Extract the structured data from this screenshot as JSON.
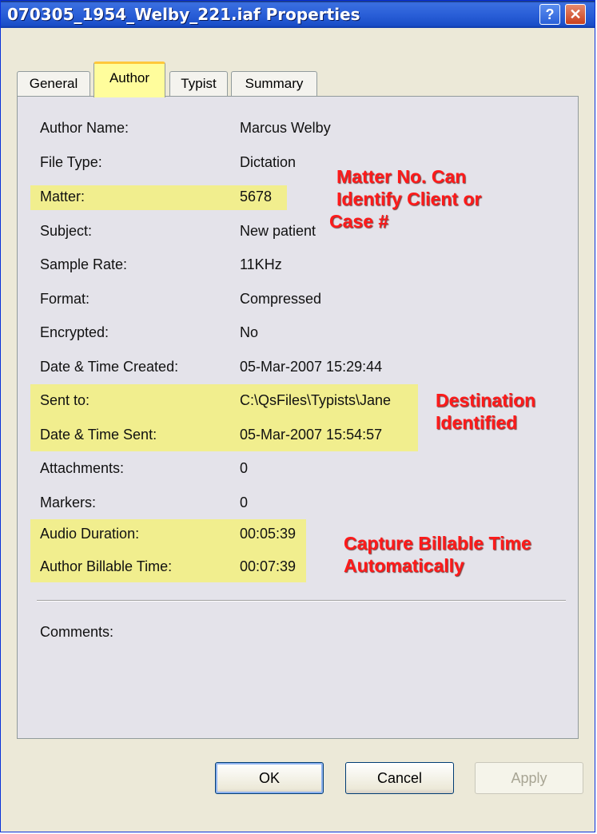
{
  "window": {
    "title": "070305_1954_Welby_221.iaf Properties",
    "help_glyph": "?",
    "close_glyph": "✕"
  },
  "tabs": [
    {
      "label": "General",
      "active": false
    },
    {
      "label": "Author",
      "active": true
    },
    {
      "label": "Typist",
      "active": false
    },
    {
      "label": "Summary",
      "active": false
    }
  ],
  "rows": [
    {
      "label": "Author Name:",
      "value": "Marcus Welby"
    },
    {
      "label": "File Type:",
      "value": "Dictation"
    },
    {
      "label": "Matter:",
      "value": "5678"
    },
    {
      "label": "Subject:",
      "value": "New patient"
    },
    {
      "label": "Sample Rate:",
      "value": "11KHz"
    },
    {
      "label": "Format:",
      "value": "Compressed"
    },
    {
      "label": "Encrypted:",
      "value": "No"
    },
    {
      "label": "Date & Time Created:",
      "value": "05-Mar-2007 15:29:44"
    },
    {
      "label": "Sent to:",
      "value": "C:\\QsFiles\\Typists\\Jane"
    },
    {
      "label": "Date & Time Sent:",
      "value": "05-Mar-2007 15:54:57"
    },
    {
      "label": "Attachments:",
      "value": "0"
    },
    {
      "label": "Markers:",
      "value": "0"
    },
    {
      "label": "Audio Duration:",
      "value": "00:05:39"
    },
    {
      "label": "Author Billable Time:",
      "value": "00:07:39"
    }
  ],
  "comments_label": "Comments:",
  "annotations": {
    "matter": [
      "Matter No. Can",
      "Identify Client or",
      "Case #"
    ],
    "destination": [
      "Destination",
      "Identified"
    ],
    "billable": [
      "Capture Billable Time",
      "Automatically"
    ]
  },
  "buttons": {
    "ok": "OK",
    "cancel": "Cancel",
    "apply": "Apply"
  },
  "colors": {
    "highlight": "#f1ee8e",
    "annotation": "#ff1a1a",
    "titlebar": "#2a5fd8"
  }
}
